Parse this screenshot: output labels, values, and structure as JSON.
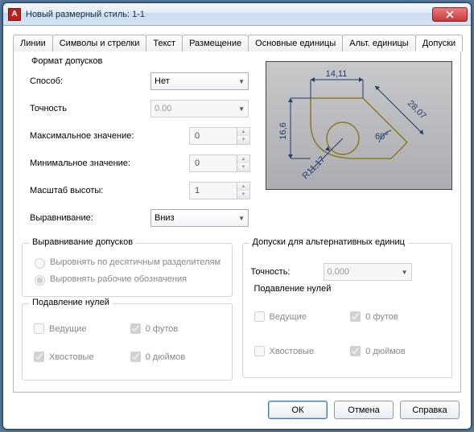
{
  "window": {
    "title": "Новый размерный стиль: 1-1",
    "appicon_letter": "A"
  },
  "tabs": {
    "items": [
      {
        "label": "Линии"
      },
      {
        "label": "Символы и стрелки"
      },
      {
        "label": "Текст"
      },
      {
        "label": "Размещение"
      },
      {
        "label": "Основные единицы"
      },
      {
        "label": "Альт. единицы"
      },
      {
        "label": "Допуски"
      }
    ]
  },
  "tolerance_format": {
    "legend": "Формат допусков",
    "method_label": "Способ:",
    "method_value": "Нет",
    "precision_label": "Точность",
    "precision_value": "0.00",
    "upper_label": "Максимальное значение:",
    "upper_value": "0",
    "lower_label": "Минимальное значение:",
    "lower_value": "0",
    "scale_label": "Масштаб высоты:",
    "scale_value": "1",
    "vertical_label": "Выравнивание:",
    "vertical_value": "Вниз"
  },
  "alignment": {
    "legend": "Выравнивание допусков",
    "decimal": "Выровнять по десятичным разделителям",
    "symbols": "Выровнять рабочие обозначения"
  },
  "zero_suppress": {
    "legend": "Подавление нулей",
    "leading": "Ведущие",
    "trailing": "Хвостовые",
    "feet": "0 футов",
    "inches": "0 дюймов"
  },
  "alt_units": {
    "legend": "Допуски для альтернативных единиц",
    "precision_label": "Точность:",
    "precision_value": "0.000",
    "suppress_legend": "Подавление нулей",
    "leading": "Ведущие",
    "trailing": "Хвостовые",
    "feet": "0 футов",
    "inches": "0 дюймов"
  },
  "buttons": {
    "ok": "ОК",
    "cancel": "Отмена",
    "help": "Справка"
  },
  "preview": {
    "dim_top": "14,11",
    "dim_left": "16,6",
    "dim_right": "28,07",
    "dim_angle": "60°",
    "dim_radius": "R11,17"
  }
}
